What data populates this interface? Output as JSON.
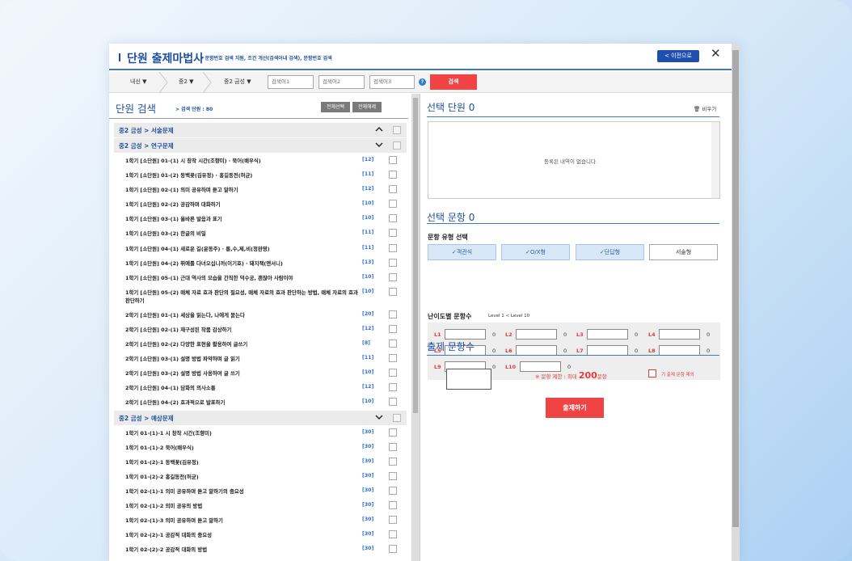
{
  "header": {
    "title": "단원 출제마법사",
    "subtitle": "- 문항번호 검색 지원, 조건 개선(검색어내 검색), 문항번호 검색",
    "prev_label": "< 이전으로",
    "close_label": "✕"
  },
  "filters": {
    "crumbs": [
      "내신 ▼",
      "중2 ▼",
      "중2 금성 ▼"
    ],
    "search_inputs": [
      "검색어1",
      "검색어2",
      "검색어3"
    ],
    "help": "?",
    "search_label": "검색"
  },
  "left": {
    "heading": "단원 검색",
    "count": "> 검색 단원 : 80",
    "select_all": "전체선택",
    "deselect_all": "전체해제",
    "groups": [
      {
        "label": "중2 금성 > 서술문제",
        "caret": "^",
        "items": []
      },
      {
        "label": "중2 금성 > 연구문제",
        "caret": "v",
        "items": [
          {
            "label": "1학기 [소단원] 01-(1) 시 창작 시간(조향미) · 묵어(배우식)",
            "count": "[12]"
          },
          {
            "label": "1학기 [소단원] 01-(2) 동백꽃(김유정) · 홍길동전(허균)",
            "count": "[11]"
          },
          {
            "label": "1학기 [소단원] 02-(1) 의미 공유하며 듣고 말하기",
            "count": "[12]"
          },
          {
            "label": "1학기 [소단원] 02-(2) 공감하며 대화하기",
            "count": "[10]"
          },
          {
            "label": "1학기 [소단원] 03-(1) 올바른 발음과 표기",
            "count": "[10]"
          },
          {
            "label": "1학기 [소단원] 03-(2) 한글의 비밀",
            "count": "[11]"
          },
          {
            "label": "1학기 [소단원] 04-(1) 새로운 길(윤동주) · 롱,수,제,비(정완영)",
            "count": "[11]"
          },
          {
            "label": "1학기 [소단원] 04-(2) 뛰예를 다녀오십니까(이기호) · 돼지책(앤서니)",
            "count": "[13]"
          },
          {
            "label": "1학기 [소단원] 05-(1) 근대 역사의 모습을 간직한 덕수궁, 괜찮아 사람이야",
            "count": "[10]"
          },
          {
            "label": "1학기 [소단원] 05-(2) 매체 자료 효과 판단의 필요성, 매체 자료의 효과 판단하는 방법, 매체 자료의 효과 판단하기",
            "count": "[10]",
            "tall": true
          },
          {
            "label": "2학기 [소단원] 01-(1) 세상을 읽는다, 나에게 묻는다",
            "count": "[20]"
          },
          {
            "label": "2학기 [소단원] 02-(1) 재구성된 작품 감상하기",
            "count": "[12]"
          },
          {
            "label": "2학기 [소단원] 02-(2) 다양한 표현을 활용하여 글쓰기",
            "count": "[8]"
          },
          {
            "label": "2학기 [소단원] 03-(1) 설명 방법 파악하며 글 읽기",
            "count": "[11]"
          },
          {
            "label": "2학기 [소단원] 03-(2) 설명 방법 사용하여 글 쓰기",
            "count": "[10]"
          },
          {
            "label": "2학기 [소단원] 04-(1) 담화의 의사소통",
            "count": "[12]"
          },
          {
            "label": "2학기 [소단원] 04-(2) 효과적으로 발표하기",
            "count": "[10]"
          }
        ]
      },
      {
        "label": "중2 금성 > 예상문제",
        "caret": "v",
        "items": [
          {
            "label": "1학기 01-(1)-1 시 창작 시간(조향미)",
            "count": "[30]"
          },
          {
            "label": "1학기 01-(1)-2 묵어(배우식)",
            "count": "[30]"
          },
          {
            "label": "1학기 01-(2)-1 동백꽃(김유정)",
            "count": "[30]"
          },
          {
            "label": "1학기 01-(2)-2 홍길동전(허균)",
            "count": "[30]"
          },
          {
            "label": "1학기 02-(1)-1 의미 공유하며 듣고 말하기의 중요성",
            "count": "[30]"
          },
          {
            "label": "1학기 02-(1)-2 의미 공유의 방법",
            "count": "[30]"
          },
          {
            "label": "1학기 02-(1)-3 의미 공유하며 듣고 말하기",
            "count": "[30]"
          },
          {
            "label": "1학기 02-(2)-1 공감적 대화의 중요성",
            "count": "[30]"
          },
          {
            "label": "1학기 02-(2)-2 공감적 대화의 방법",
            "count": "[30]"
          }
        ]
      }
    ]
  },
  "right": {
    "selected_units_heading": "선택 단원 0",
    "clear_label": "비우기",
    "empty_msg": "등록된 내역이 없습니다.",
    "selected_q_heading": "선택 문항 0",
    "type_label": "문항 유형 선택",
    "types": [
      {
        "label": "✓객관식",
        "on": true
      },
      {
        "label": "✓O/X형",
        "on": true
      },
      {
        "label": "✓단답형",
        "on": true
      },
      {
        "label": "서술형",
        "on": false
      }
    ],
    "level_label": "난이도별 문항수",
    "level_hint": "Level 1 < Level 10",
    "levels": [
      {
        "name": "L1",
        "value": "0"
      },
      {
        "name": "L2",
        "value": "0"
      },
      {
        "name": "L3",
        "value": "0"
      },
      {
        "name": "L4",
        "value": "0"
      },
      {
        "name": "L5",
        "value": "0"
      },
      {
        "name": "L6",
        "value": "0"
      },
      {
        "name": "L7",
        "value": "0"
      },
      {
        "name": "L8",
        "value": "0"
      },
      {
        "name": "L9",
        "value": "0"
      },
      {
        "name": "L10",
        "value": "0"
      }
    ],
    "count_heading": "출제 문항수",
    "limit_prefix": "※ 문항 제한 : 최대 ",
    "limit_value": "200",
    "limit_suffix": "문항",
    "exclude_label": "기 출제 문항 제외",
    "make_label": "출제하기"
  }
}
